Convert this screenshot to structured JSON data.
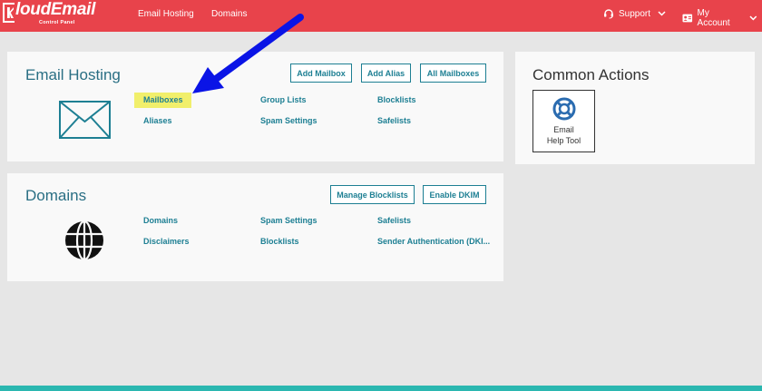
{
  "brand": {
    "name": "loudEmail",
    "subtitle": "Control Panel"
  },
  "nav": {
    "email_hosting": "Email Hosting",
    "domains": "Domains",
    "support": "Support",
    "my_account": "My Account"
  },
  "email_hosting": {
    "title": "Email Hosting",
    "buttons": {
      "add_mailbox": "Add Mailbox",
      "add_alias": "Add Alias",
      "all_mailboxes": "All Mailboxes"
    },
    "links": {
      "mailboxes": "Mailboxes",
      "aliases": "Aliases",
      "group_lists": "Group Lists",
      "spam_settings": "Spam Settings",
      "blocklists": "Blocklists",
      "safelists": "Safelists"
    }
  },
  "domains": {
    "title": "Domains",
    "buttons": {
      "manage_blocklists": "Manage Blocklists",
      "enable_dkim": "Enable DKIM"
    },
    "links": {
      "domains": "Domains",
      "disclaimers": "Disclaimers",
      "spam_settings": "Spam Settings",
      "blocklists": "Blocklists",
      "safelists": "Safelists",
      "sender_auth": "Sender Authentication (DKI..."
    }
  },
  "common_actions": {
    "title": "Common Actions",
    "email_help_line1": "Email",
    "email_help_line2": "Help Tool"
  },
  "colors": {
    "header": "#e8434b",
    "accent": "#1d7f93",
    "highlight": "#f1ef6b",
    "arrow": "#0a14e6",
    "footer": "#2bb7b0"
  },
  "icons": [
    "envelope-icon",
    "globe-icon",
    "lifebuoy-icon",
    "support-headset-icon",
    "account-card-icon",
    "chevron-down-icon",
    "arrow-annotation"
  ]
}
